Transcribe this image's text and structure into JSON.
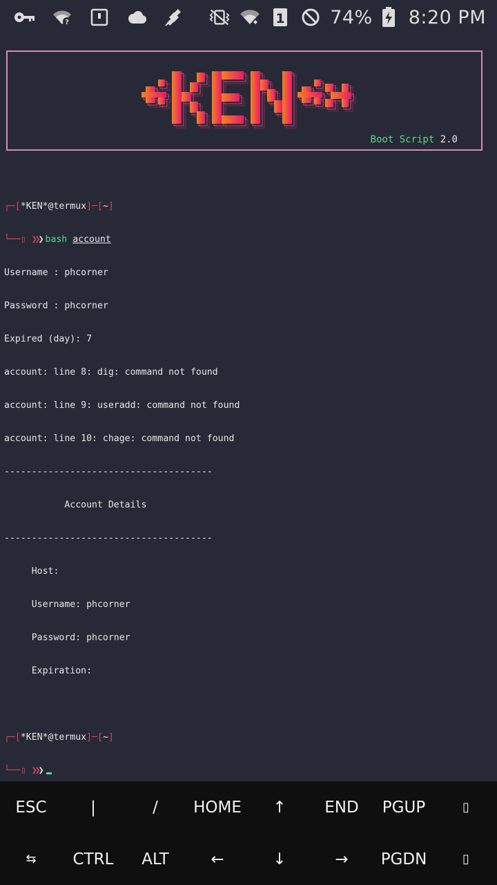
{
  "status_bar": {
    "left_icons": [
      "key-icon",
      "wifi-question-icon",
      "sim-card-icon",
      "cloud-icon",
      "satellite-icon"
    ],
    "right_icons": [
      "vibrate-mute-icon",
      "wifi-signal-icon",
      "sim-1-icon",
      "do-not-disturb-icon",
      "battery-charging-icon"
    ],
    "battery_percent": "74%",
    "time": "8:20 PM"
  },
  "banner": {
    "logo_text": "*KEN*",
    "subtitle_name": "Boot Script",
    "subtitle_version": "2.0",
    "colors": {
      "border": "#d48bb8",
      "gradient_start": "#f5821f",
      "gradient_end": "#e8196e"
    }
  },
  "terminal": {
    "prompt_user": "*KEN*@termux",
    "prompt_dir": "~",
    "command": "bash",
    "command_arg": "account",
    "output": [
      "Username : phcorner",
      "Password : phcorner",
      "Expired (day): 7",
      "account: line 8: dig: command not found",
      "account: line 9: useradd: command not found",
      "account: line 10: chage: command not found",
      "--------------------------------------",
      "           Account Details",
      "--------------------------------------",
      "     Host:",
      "     Username: phcorner",
      "     Password: phcorner",
      "     Expiration:"
    ]
  },
  "extra_keys": {
    "row1": [
      "ESC",
      "|",
      "/",
      "HOME",
      "↑",
      "END",
      "PGUP",
      "▯"
    ],
    "row2": [
      "⇆",
      "CTRL",
      "ALT",
      "←",
      "↓",
      "→",
      "PGDN",
      "▯"
    ]
  }
}
